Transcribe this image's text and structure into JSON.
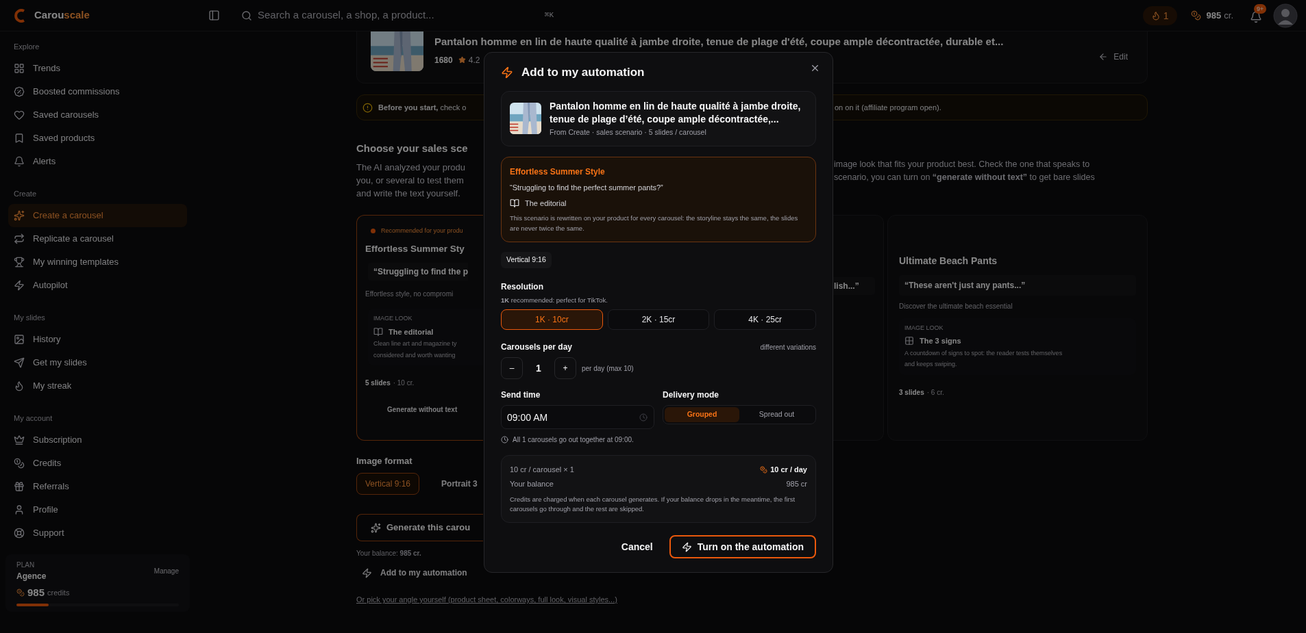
{
  "topbar": {
    "brand": {
      "first": "Carou",
      "second": "scale"
    },
    "search": {
      "placeholder": "Search a carousel, a shop, a product...",
      "shortcut": "⌘K"
    },
    "streak": "1",
    "credits": {
      "amount": "985",
      "unit": "cr."
    },
    "notifications": "9+"
  },
  "sidebar": {
    "sections": [
      {
        "label": "Explore",
        "items": [
          {
            "label": "Trends",
            "selected": false
          },
          {
            "label": "Boosted commissions",
            "selected": false
          },
          {
            "label": "Saved carousels",
            "selected": false
          },
          {
            "label": "Saved products",
            "selected": false
          },
          {
            "label": "Alerts",
            "selected": false
          }
        ]
      },
      {
        "label": "Create",
        "items": [
          {
            "label": "Create a carousel",
            "selected": true
          },
          {
            "label": "Replicate a carousel",
            "selected": false
          },
          {
            "label": "My winning templates",
            "selected": false
          },
          {
            "label": "Autopilot",
            "selected": false
          }
        ]
      },
      {
        "label": "My slides",
        "items": [
          {
            "label": "History",
            "selected": false
          },
          {
            "label": "Get my slides",
            "selected": false
          },
          {
            "label": "My streak",
            "selected": false
          }
        ]
      },
      {
        "label": "My account",
        "items": [
          {
            "label": "Subscription",
            "selected": false
          },
          {
            "label": "Credits",
            "selected": false
          },
          {
            "label": "Referrals",
            "selected": false
          },
          {
            "label": "Profile",
            "selected": false
          },
          {
            "label": "Support",
            "selected": false
          }
        ]
      }
    ],
    "plan": {
      "label": "PLAN",
      "name": "Agence",
      "manage": "Manage",
      "credits": "985",
      "unit": "credits",
      "level": 0.2
    }
  },
  "product": {
    "title": "Pantalon homme en lin de haute qualité à jambe droite, tenue de plage d'été, coupe ample décontractée, durable et...",
    "sales": "1680",
    "rating": "4.2",
    "edit": "Edit"
  },
  "banner": {
    "left": "**Before you start,** check o",
    "right": "on on it (affiliate program open)."
  },
  "intro": {
    "heading": "Choose your sales sce",
    "left_lines": [
      "The AI analyzed your produ",
      "you, or several to test them",
      "and write the text yourself."
    ],
    "right_lines": [
      "image look that fits your product best. Check the one that speaks to",
      "scenario, you can turn on **“generate without text”** to get bare slides"
    ]
  },
  "scenarios": [
    {
      "kind": "left",
      "selected": true,
      "badge": "Recommended for your produ",
      "title": "Effortless Summer Sty",
      "quote": "“Struggling to find the p",
      "description": "Effortless style, no compromi",
      "look_label": "IMAGE LOOK",
      "look_name": "The editorial",
      "look_lines": [
        "Clean line art and magazine ty",
        "considered and worth wanting"
      ],
      "slides": "5 slides",
      "cost": "· 10 cr.",
      "toggle": "Generate without text"
    },
    {
      "kind": "fragment",
      "selected": false,
      "quote": "lish...”"
    },
    {
      "kind": "right",
      "selected": false,
      "title": "Ultimate Beach Pants",
      "quote": "“These aren't just any pants...”",
      "description": "Discover the ultimate beach essential",
      "look_label": "IMAGE LOOK",
      "look_name": "The 3 signs",
      "look_lines": [
        "A countdown of signs to spot: the reader tests themselves",
        "and keeps swiping."
      ],
      "slides": "3 slides",
      "cost": "· 6 cr."
    }
  ],
  "image_format": {
    "label": "Image format",
    "options": [
      {
        "label": "Vertical 9:16",
        "selected": true
      },
      {
        "label": "Portrait 3",
        "selected": false
      }
    ]
  },
  "generate": "Generate this carou",
  "balance": "Your balance: **985 cr.**",
  "add_automation": "Add to my automation",
  "pick_link": "Or pick your angle yourself (product sheet, colorways, full look, visual styles...)",
  "modal": {
    "title": "Add to my automation",
    "product": {
      "title": "Pantalon homme en lin de haute qualité à jambe droite, tenue de plage d’été, coupe ample décontractée,...",
      "meta": "From Create · sales scenario · 5 slides / carousel"
    },
    "scenario": {
      "title": "Effortless Summer Style",
      "quote": "“Struggling to find the perfect summer pants?”",
      "look": "The editorial",
      "note": "This scenario is rewritten on your product for every carousel: the storyline stays the same, the slides are never twice the same."
    },
    "format_chip": "Vertical 9:16",
    "resolution": {
      "label": "Resolution",
      "hint": "**1K** recommended: perfect for TikTok.",
      "options": [
        {
          "label": "1K · 10cr",
          "selected": true
        },
        {
          "label": "2K · 15cr",
          "selected": false
        },
        {
          "label": "4K · 25cr",
          "selected": false
        }
      ]
    },
    "per_day": {
      "label": "Carousels per day",
      "aside": "different variations",
      "minus": "–",
      "value": "1",
      "plus": "+",
      "suffix": "per day (max 10)"
    },
    "send_time": {
      "label": "Send time",
      "value": "09:00 AM"
    },
    "delivery": {
      "label": "Delivery mode",
      "options": [
        {
          "label": "Grouped",
          "selected": true
        },
        {
          "label": "Spread out",
          "selected": false
        }
      ]
    },
    "schedule_note": "All 1 carousels go out together at 09:00.",
    "cost": {
      "per": "10 cr / carousel × 1",
      "total": "10 cr / day",
      "balance_label": "Your balance",
      "balance": "985 cr",
      "note": "Credits are charged when each carousel generates. If your balance drops in the meantime, the first carousels go through and the rest are skipped."
    },
    "cancel": "Cancel",
    "confirm": "Turn on the automation"
  }
}
